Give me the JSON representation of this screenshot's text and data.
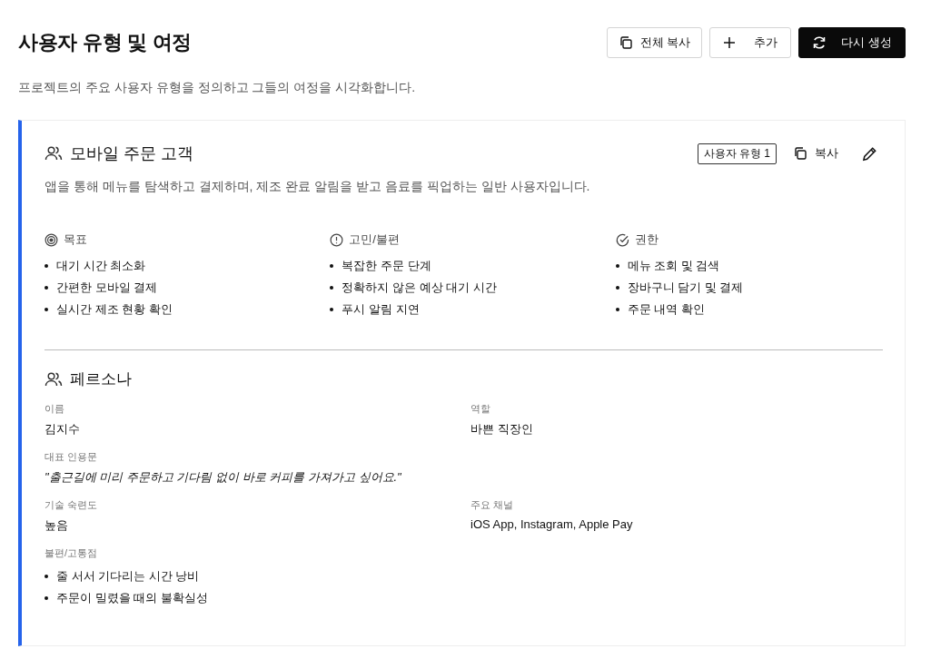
{
  "header": {
    "title": "사용자 유형 및 여정",
    "description": "프로젝트의 주요 사용자 유형을 정의하고 그들의 여정을 시각화합니다.",
    "buttons": [
      {
        "label": "전체 복사",
        "kind": "copy",
        "primary": false
      },
      {
        "label": "추가",
        "kind": "add",
        "primary": false
      },
      {
        "label": "다시 생성",
        "kind": "refresh",
        "primary": true
      }
    ]
  },
  "user_type": {
    "title": "모바일 주문 고객",
    "badge": "사용자 유형 1",
    "copy_label": "복사",
    "description": "앱을 통해 메뉴를 탐색하고 결제하며, 제조 완료 알림을 받고 음료를 픽업하는 일반 사용자입니다.",
    "sections": [
      {
        "kind": "goal",
        "title": "목표",
        "items": [
          "대기 시간 최소화",
          "간편한 모바일 결제",
          "실시간 제조 현황 확인"
        ]
      },
      {
        "kind": "pain",
        "title": "고민/불편",
        "items": [
          "복잡한 주문 단계",
          "정확하지 않은 예상 대기 시간",
          "푸시 알림 지연"
        ]
      },
      {
        "kind": "permission",
        "title": "권한",
        "items": [
          "메뉴 조회 및 검색",
          "장바구니 담기 및 결제",
          "주문 내역 확인"
        ]
      }
    ],
    "persona": {
      "title": "페르소나",
      "fields": [
        {
          "kind": "text",
          "label": "이름",
          "value": "김지수"
        },
        {
          "kind": "text",
          "label": "역할",
          "value": "바쁜 직장인"
        },
        {
          "kind": "quote",
          "label": "대표 인용문",
          "value": "\"출근길에 미리 주문하고 기다림 없이 바로 커피를 가져가고 싶어요.\""
        },
        {
          "kind": "text",
          "label": "기술 숙련도",
          "value": "높음"
        },
        {
          "kind": "text",
          "label": "주요 채널",
          "value": "iOS App, Instagram, Apple Pay"
        },
        {
          "kind": "list",
          "label": "불편/고통점",
          "items": [
            "줄 서서 기다리는 시간 낭비",
            "주문이 밀렸을 때의 불확실성"
          ]
        }
      ]
    }
  }
}
